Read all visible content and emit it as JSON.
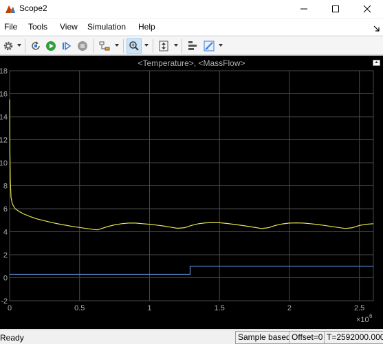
{
  "window": {
    "title": "Scope2",
    "icon": "matlab-scope-icon",
    "controls": [
      "minimize-icon",
      "maximize-icon",
      "close-icon"
    ]
  },
  "menu": {
    "items": [
      "File",
      "Tools",
      "View",
      "Simulation",
      "Help"
    ],
    "overflow_icon": "dock-arrow-icon"
  },
  "toolbar": {
    "buttons": [
      "settings-gear-icon",
      "step-back-icon",
      "run-icon",
      "step-forward-icon",
      "stop-icon",
      "highlight-block-icon",
      "zoom-in-icon",
      "autoscale-axes-icon",
      "triggers-icon",
      "measurements-icon"
    ],
    "run_color": "#2e9e3a",
    "active_button": "zoom-in-icon"
  },
  "plot": {
    "title": "<Temperature>, <MassFlow>",
    "undock_icon": "undock-icon",
    "background": "#000000",
    "grid_color": "#4a4a4a",
    "axis_text_color": "#b0b0b0",
    "exponent_label": "×10",
    "exponent_power": "6"
  },
  "chart_data": {
    "type": "line",
    "title": "<Temperature>, <MassFlow>",
    "xlabel": "",
    "ylabel": "",
    "xlim": [
      0,
      2.6
    ],
    "ylim": [
      -2,
      18
    ],
    "x_scale_note": "×10^6",
    "x_ticks": [
      "0",
      "0.5",
      "1",
      "1.5",
      "2",
      "2.5"
    ],
    "y_ticks": [
      "-2",
      "0",
      "2",
      "4",
      "6",
      "8",
      "10",
      "12",
      "14",
      "16",
      "18"
    ],
    "grid": true,
    "series": [
      {
        "color": "#e6e64a",
        "x": [
          0,
          0.002,
          0.005,
          0.01,
          0.02,
          0.04,
          0.07,
          0.1,
          0.15,
          0.2,
          0.25,
          0.3,
          0.35,
          0.4,
          0.45,
          0.5,
          0.55,
          0.6,
          0.63,
          0.65,
          0.7,
          0.75,
          0.8,
          0.85,
          0.9,
          0.95,
          1.0,
          1.05,
          1.1,
          1.15,
          1.2,
          1.25,
          1.3,
          1.35,
          1.4,
          1.45,
          1.5,
          1.55,
          1.6,
          1.65,
          1.7,
          1.75,
          1.8,
          1.85,
          1.9,
          1.95,
          2.0,
          2.05,
          2.1,
          2.15,
          2.2,
          2.25,
          2.3,
          2.35,
          2.4,
          2.45,
          2.5,
          2.55,
          2.6
        ],
        "y": [
          15.5,
          11.0,
          8.5,
          7.0,
          6.4,
          6.0,
          5.75,
          5.55,
          5.3,
          5.1,
          4.95,
          4.8,
          4.68,
          4.57,
          4.46,
          4.37,
          4.28,
          4.2,
          4.17,
          4.25,
          4.45,
          4.6,
          4.7,
          4.75,
          4.75,
          4.7,
          4.65,
          4.58,
          4.5,
          4.4,
          4.3,
          4.35,
          4.55,
          4.7,
          4.77,
          4.8,
          4.78,
          4.72,
          4.65,
          4.57,
          4.48,
          4.38,
          4.28,
          4.35,
          4.55,
          4.68,
          4.75,
          4.77,
          4.75,
          4.7,
          4.63,
          4.55,
          4.46,
          4.37,
          4.28,
          4.35,
          4.55,
          4.65,
          4.7
        ]
      },
      {
        "color": "#5a8fd8",
        "x": [
          0,
          1.29,
          1.29,
          2.6
        ],
        "y": [
          0.3,
          0.3,
          1.0,
          1.0
        ]
      }
    ]
  },
  "status": {
    "ready": "Ready",
    "mode": "Sample based",
    "offset": "Offset=0",
    "time": "T=2592000.000"
  }
}
